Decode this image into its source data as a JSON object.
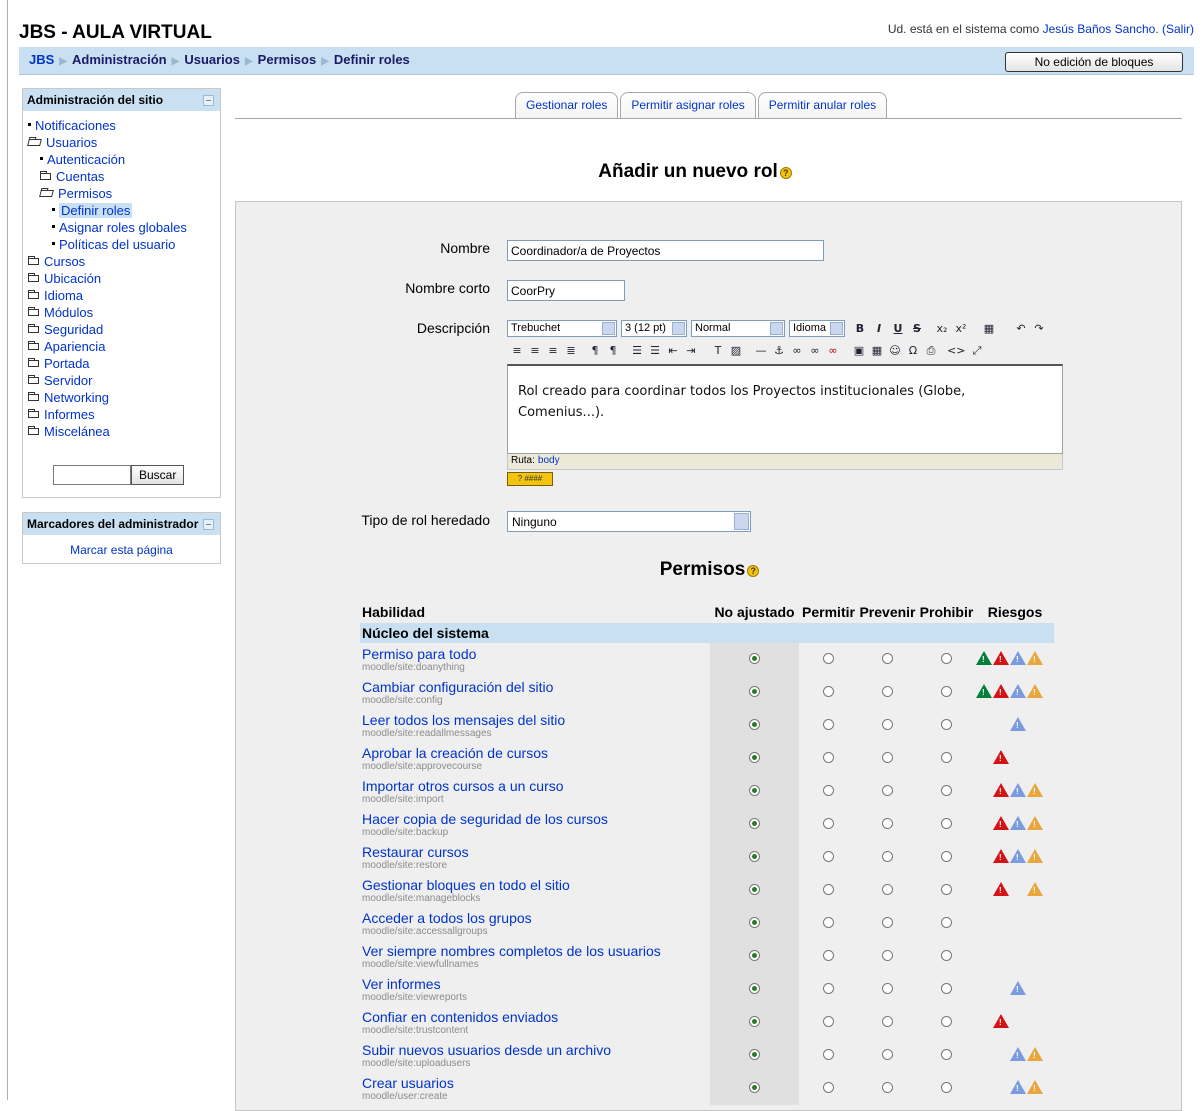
{
  "header": {
    "site_title": "JBS - AULA VIRTUAL",
    "login_prefix": "Ud. está en el sistema como",
    "user_name": "Jesús Baños Sancho",
    "logout": "(Salir)",
    "edit_blocks_button": "No edición de bloques"
  },
  "breadcrumb": [
    "JBS",
    "Administración",
    "Usuarios",
    "Permisos",
    "Definir roles"
  ],
  "admin_block": {
    "title": "Administración del sitio",
    "items": [
      {
        "label": "Notificaciones",
        "type": "leaf",
        "indent": 0
      },
      {
        "label": "Usuarios",
        "type": "open",
        "indent": 0
      },
      {
        "label": "Autenticación",
        "type": "leaf",
        "indent": 1
      },
      {
        "label": "Cuentas",
        "type": "folder",
        "indent": 1
      },
      {
        "label": "Permisos",
        "type": "open",
        "indent": 1
      },
      {
        "label": "Definir roles",
        "type": "leaf",
        "indent": 2,
        "selected": true
      },
      {
        "label": "Asignar roles globales",
        "type": "leaf",
        "indent": 2
      },
      {
        "label": "Políticas del usuario",
        "type": "leaf",
        "indent": 2
      },
      {
        "label": "Cursos",
        "type": "folder",
        "indent": 0
      },
      {
        "label": "Ubicación",
        "type": "folder",
        "indent": 0
      },
      {
        "label": "Idioma",
        "type": "folder",
        "indent": 0
      },
      {
        "label": "Módulos",
        "type": "folder",
        "indent": 0
      },
      {
        "label": "Seguridad",
        "type": "folder",
        "indent": 0
      },
      {
        "label": "Apariencia",
        "type": "folder",
        "indent": 0
      },
      {
        "label": "Portada",
        "type": "folder",
        "indent": 0
      },
      {
        "label": "Servidor",
        "type": "folder",
        "indent": 0
      },
      {
        "label": "Networking",
        "type": "folder",
        "indent": 0
      },
      {
        "label": "Informes",
        "type": "folder",
        "indent": 0
      },
      {
        "label": "Miscelánea",
        "type": "folder",
        "indent": 0
      }
    ],
    "search_button": "Buscar",
    "search_value": ""
  },
  "bookmarks_block": {
    "title": "Marcadores del administrador",
    "link": "Marcar esta página"
  },
  "tabs": [
    "Gestionar roles",
    "Permitir asignar roles",
    "Permitir anular roles"
  ],
  "page_heading": "Añadir un nuevo rol",
  "form": {
    "name_label": "Nombre",
    "name_value": "Coordinador/a de Proyectos",
    "shortname_label": "Nombre corto",
    "shortname_value": "CoorPry",
    "description_label": "Descripción",
    "editor": {
      "font": "Trebuchet",
      "size": "3 (12 pt)",
      "style": "Normal",
      "language": "Idioma",
      "content": "Rol creado para coordinar todos los Proyectos institucionales (Globe, Comenius...).",
      "path_label": "Ruta:",
      "path_value": "body"
    },
    "inherit_label": "Tipo de rol heredado",
    "inherit_value": "Ninguno"
  },
  "permissions": {
    "heading": "Permisos",
    "columns": {
      "capability": "Habilidad",
      "not_set": "No ajustado",
      "allow": "Permitir",
      "prevent": "Prevenir",
      "prohibit": "Prohibir",
      "risks": "Riesgos"
    },
    "section": "Núcleo del sistema",
    "rows": [
      {
        "name": "Permiso para todo",
        "code": "moodle/site:doanything",
        "risks": [
          "green",
          "red",
          "blue",
          "orange"
        ]
      },
      {
        "name": "Cambiar configuración del sitio",
        "code": "moodle/site:config",
        "risks": [
          "green",
          "red",
          "blue",
          "orange"
        ]
      },
      {
        "name": "Leer todos los mensajes del sitio",
        "code": "moodle/site:readallmessages",
        "risks": [
          "blank",
          "blank",
          "blue"
        ]
      },
      {
        "name": "Aprobar la creación de cursos",
        "code": "moodle/site:approvecourse",
        "risks": [
          "blank",
          "red"
        ]
      },
      {
        "name": "Importar otros cursos a un curso",
        "code": "moodle/site:import",
        "risks": [
          "blank",
          "red",
          "blue",
          "orange"
        ]
      },
      {
        "name": "Hacer copia de seguridad de los cursos",
        "code": "moodle/site:backup",
        "risks": [
          "blank",
          "red",
          "blue",
          "orange"
        ]
      },
      {
        "name": "Restaurar cursos",
        "code": "moodle/site:restore",
        "risks": [
          "blank",
          "red",
          "blue",
          "orange"
        ]
      },
      {
        "name": "Gestionar bloques en todo el sitio",
        "code": "moodle/site:manageblocks",
        "risks": [
          "blank",
          "red",
          "blank",
          "orange"
        ]
      },
      {
        "name": "Acceder a todos los grupos",
        "code": "moodle/site:accessallgroups",
        "risks": []
      },
      {
        "name": "Ver siempre nombres completos de los usuarios",
        "code": "moodle/site:viewfullnames",
        "risks": []
      },
      {
        "name": "Ver informes",
        "code": "moodle/site:viewreports",
        "risks": [
          "blank",
          "blank",
          "blue"
        ]
      },
      {
        "name": "Confiar en contenidos enviados",
        "code": "moodle/site:trustcontent",
        "risks": [
          "blank",
          "red"
        ]
      },
      {
        "name": "Subir nuevos usuarios desde un archivo",
        "code": "moodle/site:uploadusers",
        "risks": [
          "blank",
          "blank",
          "blue",
          "orange"
        ]
      },
      {
        "name": "Crear usuarios",
        "code": "moodle/user:create",
        "risks": [
          "blank",
          "blank",
          "blue",
          "orange"
        ]
      }
    ]
  },
  "colors": {
    "nav_bar": "#c8e0f2",
    "link": "#0033cc",
    "risk_green": "#00803a",
    "risk_red": "#d41414",
    "risk_blue": "#7a9be0",
    "risk_orange": "#e9a63c"
  }
}
